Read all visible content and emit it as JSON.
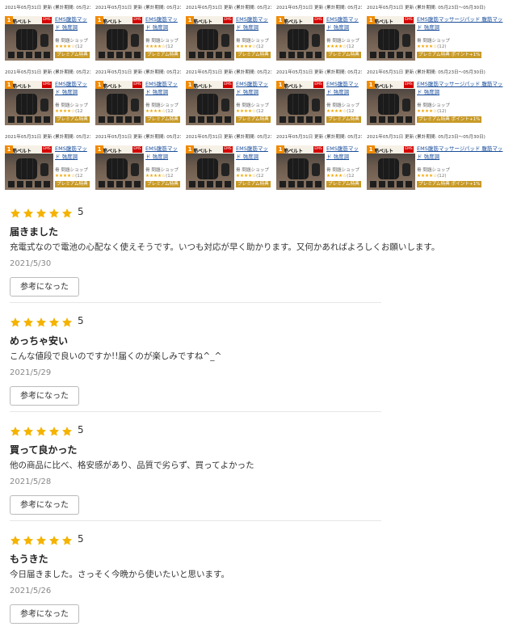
{
  "grid": {
    "rows": [
      {
        "cells": [
          {
            "update": "2021年05月31日 更新 (累計期間: 05月23",
            "title1": "EMS腹筋マッ",
            "title2": "ド 強度調",
            "shop": "骨 問題ショップ",
            "rating": "★★★★☆",
            "count": "(12",
            "premium": "プレミアム特典",
            "band": "腹筋ベルト",
            "num": "1",
            "tag": "EMS"
          },
          {
            "update": "2021年05月31日 更新 (累計期間: 05月23",
            "title1": "EMS腹筋マッ",
            "title2": "ド 強度調",
            "shop": "骨 問題ショップ",
            "rating": "★★★★☆",
            "count": "(12",
            "premium": "プレミアム特典",
            "band": "腹筋ベルト",
            "num": "1",
            "tag": "EMS"
          },
          {
            "update": "2021年05月31日 更新 (累計期間: 05月23",
            "title1": "EMS腹筋マッ",
            "title2": "ド 強度調",
            "shop": "骨 問題ショップ",
            "rating": "★★★★☆",
            "count": "(12",
            "premium": "プレミアム特典",
            "band": "腹筋ベルト",
            "num": "1",
            "tag": "EMS"
          },
          {
            "update": "2021年05月31日 更新 (累計期間: 05月23",
            "title1": "EMS腹筋マッ",
            "title2": "ド 強度調",
            "shop": "骨 問題ショップ",
            "rating": "★★★★☆",
            "count": "(12",
            "premium": "プレミアム特典",
            "band": "腹筋ベルト",
            "num": "1",
            "tag": "EMS"
          },
          {
            "update": "2021年05月31日 更新 (累計期間: 05月23日〜05月30日)",
            "title1": "EMS腹筋マッサージパッド 腹筋マッ",
            "title2": "ド 強度調",
            "shop": "骨 問題ショップ",
            "rating": "★★★★☆",
            "count": "(12)",
            "premium": "プレミアム特典 ポイント+1%",
            "band": "腹筋ベルト",
            "num": "1",
            "tag": "EMS"
          }
        ]
      },
      {
        "cells": [
          {
            "update": "2021年05月31日 更新 (累計期間: 05月23",
            "title1": "EMS腹筋マッ",
            "title2": "ド 強度調",
            "shop": "骨 問題ショップ",
            "rating": "★★★★☆",
            "count": "(12",
            "premium": "プレミアム特典",
            "band": "腹筋ベルト",
            "num": "1",
            "tag": "EMS"
          },
          {
            "update": "2021年05月31日 更新 (累計期間: 05月23",
            "title1": "EMS腹筋マッ",
            "title2": "ド 強度調",
            "shop": "骨 問題ショップ",
            "rating": "★★★★☆",
            "count": "(12",
            "premium": "プレミアム特典",
            "band": "腹筋ベルト",
            "num": "1",
            "tag": "EMS"
          },
          {
            "update": "2021年05月31日 更新 (累計期間: 05月23",
            "title1": "EMS腹筋マッ",
            "title2": "ド 強度調",
            "shop": "骨 問題ショップ",
            "rating": "★★★★☆",
            "count": "(12",
            "premium": "プレミアム特典",
            "band": "腹筋ベルト",
            "num": "1",
            "tag": "EMS"
          },
          {
            "update": "2021年05月31日 更新 (累計期間: 05月23",
            "title1": "EMS腹筋マッ",
            "title2": "ド 強度調",
            "shop": "骨 問題ショップ",
            "rating": "★★★★☆",
            "count": "(12",
            "premium": "プレミアム特典",
            "band": "腹筋ベルト",
            "num": "1",
            "tag": "EMS"
          },
          {
            "update": "2021年05月31日 更新 (累計期間: 05月23日〜05月30日)",
            "title1": "EMS腹筋マッサージパッド 腹筋マッ",
            "title2": "ド 強度調",
            "shop": "骨 問題ショップ",
            "rating": "★★★★☆",
            "count": "(12)",
            "premium": "プレミアム特典 ポイント+1%",
            "band": "腹筋ベルト",
            "num": "1",
            "tag": "EMS"
          }
        ]
      },
      {
        "cells": [
          {
            "update": "2021年05月31日 更新 (累計期間: 05月23",
            "title1": "EMS腹筋マッ",
            "title2": "ド 強度調",
            "shop": "骨 問題ショップ",
            "rating": "★★★★☆",
            "count": "(12",
            "premium": "プレミアム特典",
            "band": "腹筋ベルト",
            "num": "1",
            "tag": "EMS"
          },
          {
            "update": "2021年05月31日 更新 (累計期間: 05月23",
            "title1": "EMS腹筋マッ",
            "title2": "ド 強度調",
            "shop": "骨 問題ショップ",
            "rating": "★★★★☆",
            "count": "(12",
            "premium": "プレミアム特典",
            "band": "腹筋ベルト",
            "num": "1",
            "tag": "EMS"
          },
          {
            "update": "2021年05月31日 更新 (累計期間: 05月23",
            "title1": "EMS腹筋マッ",
            "title2": "ド 強度調",
            "shop": "骨 問題ショップ",
            "rating": "★★★★☆",
            "count": "(12",
            "premium": "プレミアム特典",
            "band": "腹筋ベルト",
            "num": "1",
            "tag": "EMS"
          },
          {
            "update": "2021年05月31日 更新 (累計期間: 05月23",
            "title1": "EMS腹筋マッ",
            "title2": "ド 強度調",
            "shop": "骨 問題ショップ",
            "rating": "★★★★☆",
            "count": "(12",
            "premium": "プレミアム特典",
            "band": "腹筋ベルト",
            "num": "1",
            "tag": "EMS"
          },
          {
            "update": "2021年05月31日 更新 (累計期間: 05月23日〜05月30日)",
            "title1": "EMS腹筋マッサージパッド 腹筋マッ",
            "title2": "ド 強度調",
            "shop": "骨 問題ショップ",
            "rating": "★★★★☆",
            "count": "(12)",
            "premium": "プレミアム特典 ポイント+1%",
            "band": "腹筋ベルト",
            "num": "1",
            "tag": "EMS"
          }
        ]
      }
    ]
  },
  "reviews": [
    {
      "stars": 5,
      "score": "5",
      "title": "届きました",
      "body": "充電式なので電池の心配なく使えそうです。いつも対応が早く助かります。又何かあればよろしくお願いします。",
      "date": "2021/5/30",
      "helpful_label": "参考になった"
    },
    {
      "stars": 5,
      "score": "5",
      "title": "めっちゃ安い",
      "body": "こんな値段で良いのですか!!届くのが楽しみですね^_^",
      "date": "2021/5/29",
      "helpful_label": "参考になった"
    },
    {
      "stars": 5,
      "score": "5",
      "title": "買って良かった",
      "body": "他の商品に比べ、格安感があり、品質で劣らず、買ってよかった",
      "date": "2021/5/28",
      "helpful_label": "参考になった"
    },
    {
      "stars": 5,
      "score": "5",
      "title": "もうきた",
      "body": "今日届きました。さっそく今晩から使いたいと思います。",
      "date": "2021/5/26",
      "helpful_label": "参考になった"
    }
  ],
  "colors": {
    "star": "#f5b301",
    "link": "#1a4e9a",
    "premium": "#c89a27"
  }
}
